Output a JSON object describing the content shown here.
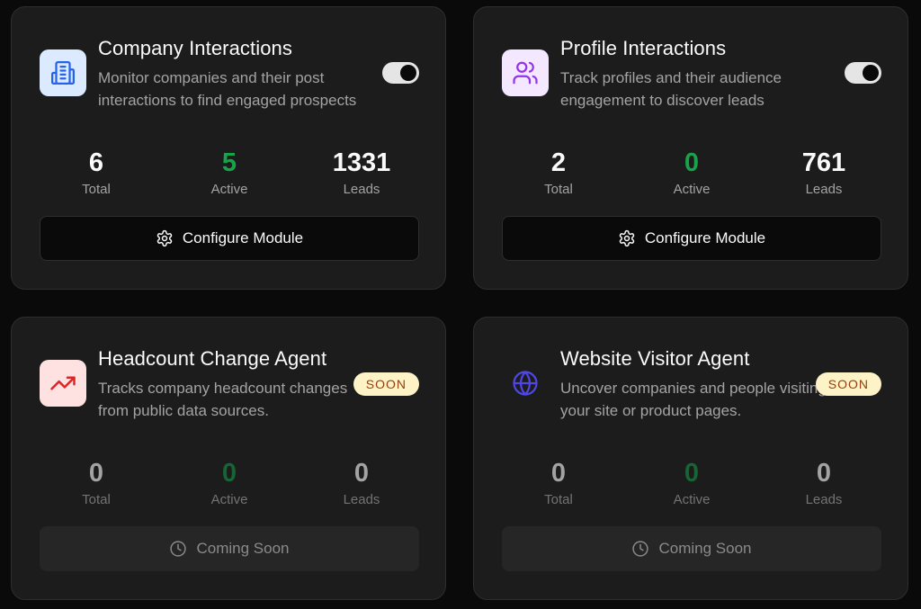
{
  "modules": [
    {
      "title": "Company Interactions",
      "description": "Monitor companies and their post interactions to find engaged prospects",
      "icon": "building-icon",
      "status": "toggle-on",
      "stats": {
        "total": "6",
        "active": "5",
        "leads": "1331"
      },
      "button_label": "Configure Module"
    },
    {
      "title": "Profile Interactions",
      "description": "Track profiles and their audience engagement to discover leads",
      "icon": "users-icon",
      "status": "toggle-on",
      "stats": {
        "total": "2",
        "active": "0",
        "leads": "761"
      },
      "button_label": "Configure Module"
    },
    {
      "title": "Headcount Change Agent",
      "description": "Tracks company headcount changes from public data sources.",
      "icon": "trending-up-icon",
      "badge": "SOON",
      "stats": {
        "total": "0",
        "active": "0",
        "leads": "0"
      },
      "button_label": "Coming Soon"
    },
    {
      "title": "Website Visitor Agent",
      "description": "Uncover companies and people visiting your site or product pages.",
      "icon": "globe-icon",
      "badge": "SOON",
      "stats": {
        "total": "0",
        "active": "0",
        "leads": "0"
      },
      "button_label": "Coming Soon"
    }
  ],
  "labels": {
    "total": "Total",
    "active": "Active",
    "leads": "Leads"
  },
  "colors": {
    "background": "#0a0a0a",
    "card": "#1c1c1c",
    "active_green": "#16a34a",
    "badge_bg": "#fef3c7",
    "badge_text": "#92400e",
    "building_icon": "#2563eb",
    "users_icon": "#9333ea",
    "trend_icon": "#dc2626",
    "globe_icon": "#4f46e5"
  }
}
